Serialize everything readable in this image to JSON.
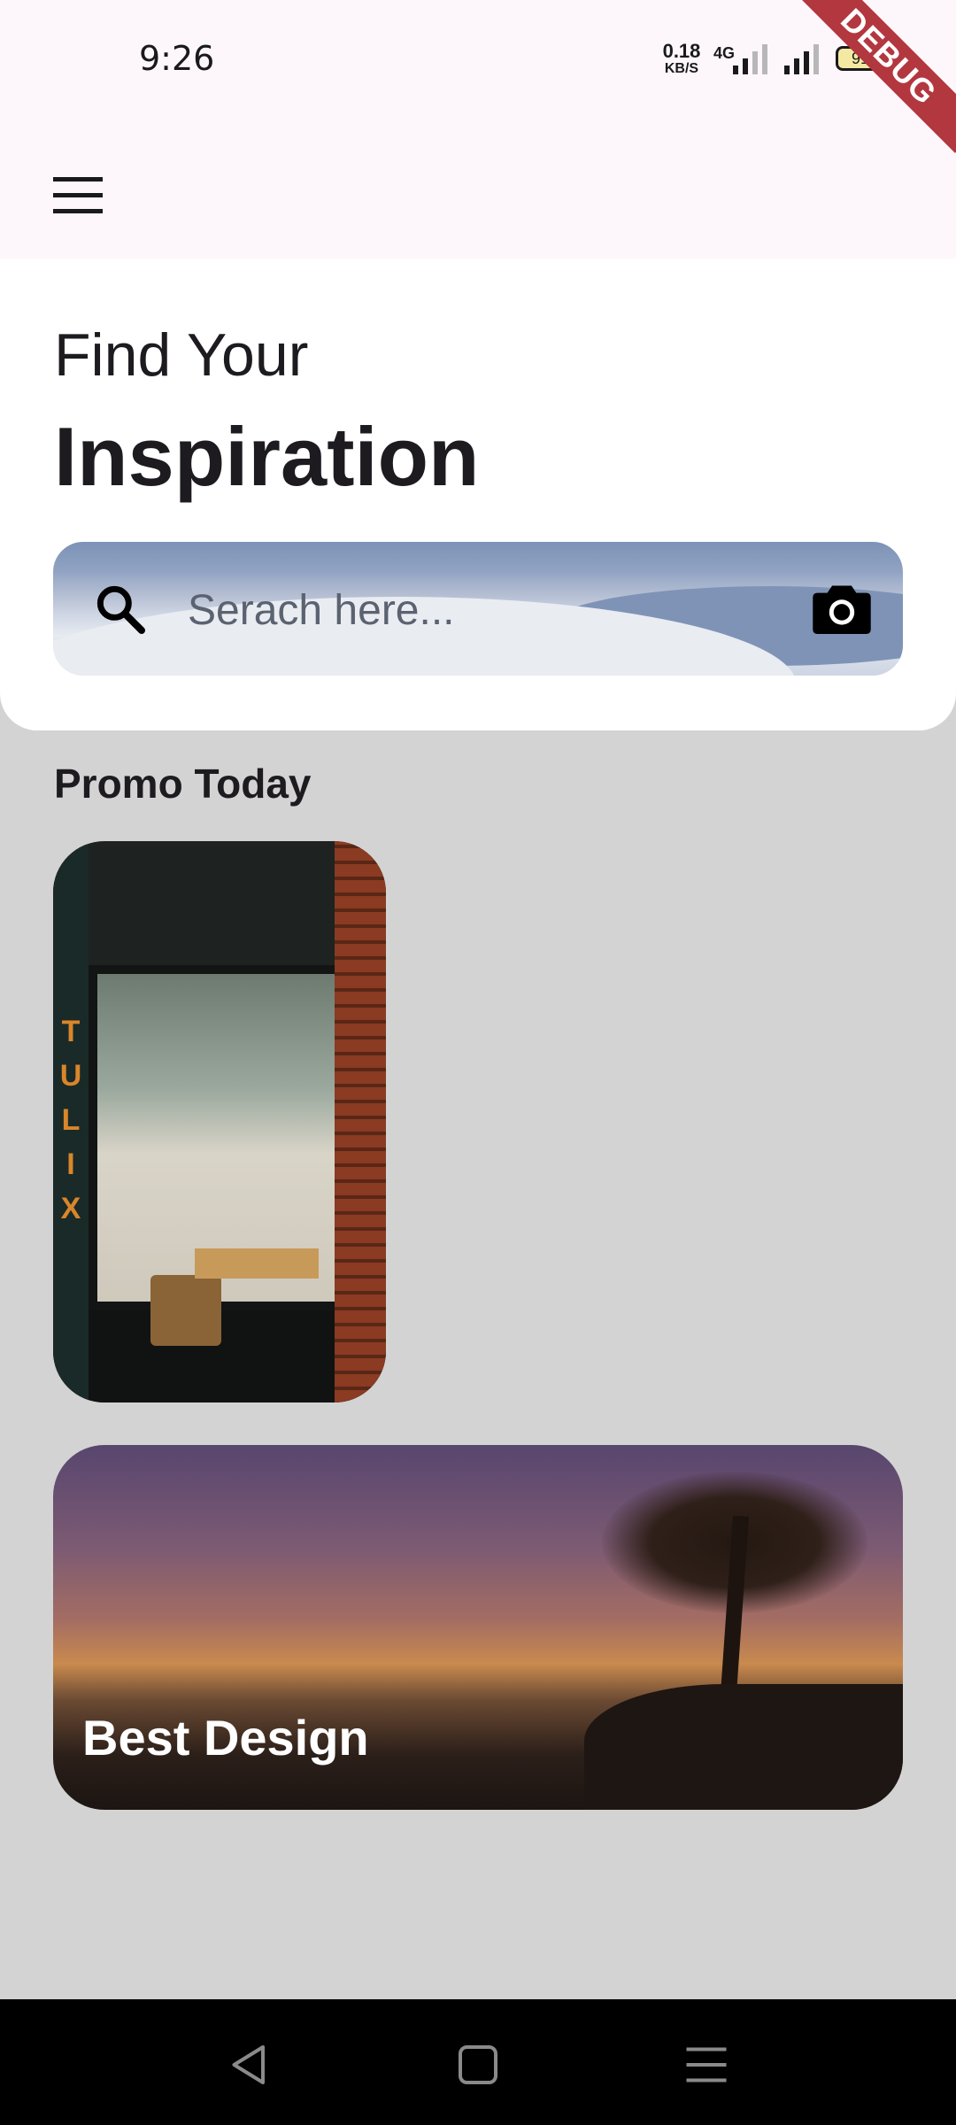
{
  "status_bar": {
    "time": "9:26",
    "net_speed_value": "0.18",
    "net_speed_unit": "KB/S",
    "network_type": "4G",
    "battery": "91",
    "debug_banner": "DEBUG"
  },
  "header": {
    "subtitle": "Find Your",
    "title": "Inspiration"
  },
  "search": {
    "placeholder": "Serach here..."
  },
  "promo": {
    "section_title": "Promo Today",
    "sign_text": "TULIX"
  },
  "banner": {
    "title": "Best Design"
  },
  "icons": {
    "menu": "hamburger-menu-icon",
    "search": "search-icon",
    "camera": "camera-icon",
    "nav_back": "back-triangle-icon",
    "nav_home": "home-square-icon",
    "nav_recents": "recents-lines-icon"
  },
  "colors": {
    "status_bg": "#fdf7fc",
    "page_bg": "#d3d3d3",
    "card_bg": "#ffffff",
    "debug_ribbon": "#b3373f"
  }
}
